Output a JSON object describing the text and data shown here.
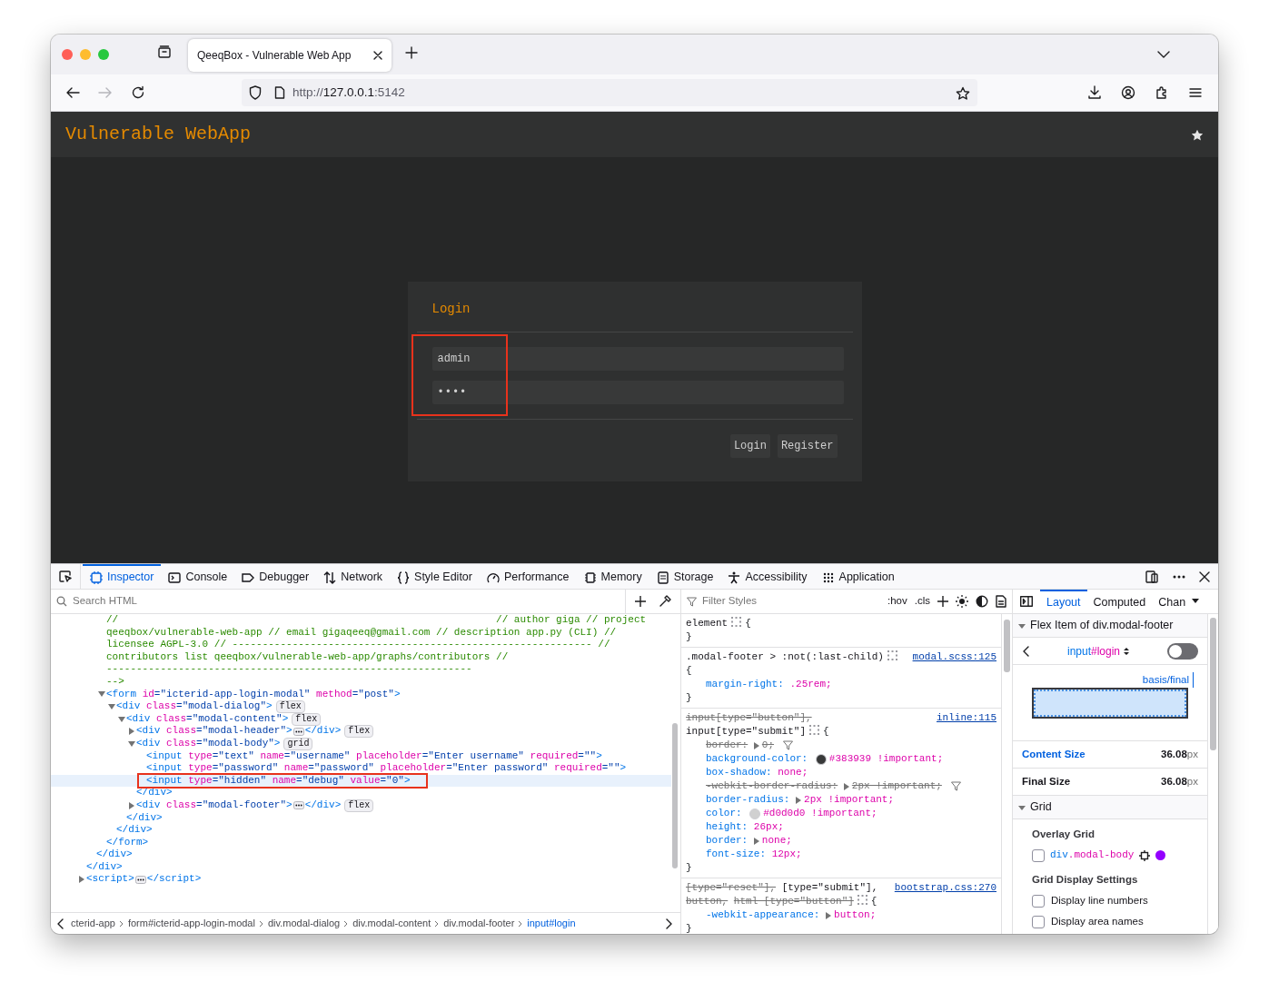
{
  "browser": {
    "tab": {
      "title": "QeeqBox - Vulnerable Web App"
    },
    "url": {
      "scheme": "http://",
      "host": "127.0.0.1",
      "port": ":5142"
    },
    "forward_disabled": true
  },
  "page": {
    "brand": "Vulnerable WebApp",
    "modal": {
      "title": "Login",
      "fields": [
        {
          "kind": "text",
          "value": "admin"
        },
        {
          "kind": "password",
          "value": "••••"
        }
      ],
      "buttons": [
        "Login",
        "Register"
      ]
    }
  },
  "devtools": {
    "tabs": [
      {
        "label": "Inspector",
        "selected": true
      },
      {
        "label": "Console",
        "selected": false
      },
      {
        "label": "Debugger",
        "selected": false
      },
      {
        "label": "Network",
        "selected": false
      },
      {
        "label": "Style Editor",
        "selected": false
      },
      {
        "label": "Performance",
        "selected": false
      },
      {
        "label": "Memory",
        "selected": false
      },
      {
        "label": "Storage",
        "selected": false
      },
      {
        "label": "Accessibility",
        "selected": false
      },
      {
        "label": "Application",
        "selected": false
      }
    ],
    "inspector": {
      "search_placeholder": "Search HTML",
      "tree": [
        {
          "kind": "tail",
          "close": "</div>",
          "children": [
            {
              "kind": "tail",
              "close": "</div>",
              "children": [
                {
                  "kind": "comment",
                  "lines": [
                    "//                                                               // author giga // project",
                    "qeeqbox/vulnerable-web-app // email gigaqeeq@gmail.com // description app.py (CLI) //",
                    "licensee AGPL-3.0 // ------------------------------------------------------------ //",
                    "contributors list qeeqbox/vulnerable-web-app/graphs/contributors //",
                    "-------------------------------------------------------------",
                    "-->"
                  ]
                },
                {
                  "kind": "element",
                  "open": "<form",
                  "attrs": [
                    {
                      "name": "id",
                      "value": "=\"icterid-app-login-modal\""
                    },
                    {
                      "name": "method",
                      "value": "=\"post\""
                    }
                  ],
                  "end": ">",
                  "close": "</form>",
                  "expanded": true,
                  "children": [
                    {
                      "kind": "element",
                      "open": "<div",
                      "attrs": [
                        {
                          "name": "class",
                          "value": "=\"modal-dialog\""
                        }
                      ],
                      "end": ">",
                      "close": "</div>",
                      "badge": "flex",
                      "expanded": true,
                      "children": [
                        {
                          "kind": "element",
                          "open": "<div",
                          "attrs": [
                            {
                              "name": "class",
                              "value": "=\"modal-content\""
                            }
                          ],
                          "end": ">",
                          "close": "</div>",
                          "badge": "flex",
                          "expanded": true,
                          "children": [
                            {
                              "kind": "element",
                              "open": "<div",
                              "attrs": [
                                {
                                  "name": "class",
                                  "value": "=\"modal-header\""
                                }
                              ],
                              "end": ">",
                              "close": "</div>",
                              "badge": "flex",
                              "expanded": false
                            },
                            {
                              "kind": "element",
                              "open": "<div",
                              "attrs": [
                                {
                                  "name": "class",
                                  "value": "=\"modal-body\""
                                }
                              ],
                              "end": ">",
                              "close": "</div>",
                              "badge": "grid",
                              "expanded": true,
                              "children": [
                                {
                                  "kind": "void",
                                  "open": "<input",
                                  "attrs": [
                                    {
                                      "name": "type",
                                      "value": "=\"text\""
                                    },
                                    {
                                      "name": "name",
                                      "value": "=\"username\""
                                    },
                                    {
                                      "name": "placeholder",
                                      "value": "=\"Enter username\""
                                    },
                                    {
                                      "name": "required",
                                      "value": "=\"\""
                                    }
                                  ],
                                  "end": ">",
                                  "highlighted": false
                                },
                                {
                                  "kind": "void",
                                  "open": "<input",
                                  "attrs": [
                                    {
                                      "name": "type",
                                      "value": "=\"password\""
                                    },
                                    {
                                      "name": "name",
                                      "value": "=\"password\""
                                    },
                                    {
                                      "name": "placeholder",
                                      "value": "=\"Enter password\""
                                    },
                                    {
                                      "name": "required",
                                      "value": "=\"\""
                                    }
                                  ],
                                  "end": ">",
                                  "highlighted": false
                                },
                                {
                                  "kind": "void",
                                  "open": "<input",
                                  "attrs": [
                                    {
                                      "name": "type",
                                      "value": "=\"hidden\""
                                    },
                                    {
                                      "name": "name",
                                      "value": "=\"debug\""
                                    },
                                    {
                                      "name": "value",
                                      "value": "=\"0\""
                                    }
                                  ],
                                  "end": ">",
                                  "highlighted": true
                                }
                              ]
                            },
                            {
                              "kind": "element",
                              "open": "<div",
                              "attrs": [
                                {
                                  "name": "class",
                                  "value": "=\"modal-footer\""
                                }
                              ],
                              "end": ">",
                              "close": "</div>",
                              "badge": "flex",
                              "expanded": false
                            }
                          ]
                        }
                      ]
                    }
                  ]
                }
              ]
            }
          ]
        },
        {
          "kind": "element",
          "open": "<script",
          "end": ">",
          "close": "</script>",
          "expanded": false
        }
      ],
      "breadcrumbs": [
        {
          "label": "cterid-app",
          "selected": false
        },
        {
          "label": "form#icterid-app-login-modal",
          "selected": false
        },
        {
          "label": "div.modal-dialog",
          "selected": false
        },
        {
          "label": "div.modal-content",
          "selected": false
        },
        {
          "label": "div.modal-footer",
          "selected": false
        },
        {
          "label": "input#login",
          "selected": true
        }
      ]
    },
    "styles": {
      "filter_placeholder": "Filter Styles",
      "toggles": [
        ":hov",
        ".cls"
      ],
      "rules": [
        {
          "selector": [
            {
              "text": "element",
              "overridden": false
            }
          ],
          "open": "{",
          "close": "}"
        },
        {
          "selector": [
            {
              "text": ".modal-footer > :not(:last-child)",
              "overridden": false
            }
          ],
          "source": "modal.scss:125",
          "open": "{",
          "close": "}",
          "declarations": [
            {
              "property": "margin-right:",
              "value": ".25rem;",
              "overridden": false,
              "flagged": false
            }
          ]
        },
        {
          "selector": [
            {
              "text": "input[type=\"button\"],",
              "overridden": true
            },
            {
              "text": "input[type=\"submit\"]",
              "overridden": false
            }
          ],
          "source": "inline:115",
          "open": "{",
          "close": "}",
          "declarations": [
            {
              "property": "border:",
              "value": "0;",
              "overridden": true,
              "flagged": true,
              "expanded": false
            },
            {
              "property": "background-color:",
              "value": "#383939 !important;",
              "overridden": false,
              "flagged": false,
              "color": "#383939"
            },
            {
              "property": "box-shadow:",
              "value": "none;",
              "overridden": false,
              "flagged": false
            },
            {
              "property": "-webkit-border-radius:",
              "value": "2px !important;",
              "overridden": true,
              "flagged": true,
              "expanded": false
            },
            {
              "property": "border-radius:",
              "value": "2px !important;",
              "overridden": false,
              "flagged": false,
              "expanded": false
            },
            {
              "property": "color:",
              "value": "#d0d0d0 !important;",
              "overridden": false,
              "flagged": false,
              "color": "#d0d0d0"
            },
            {
              "property": "height:",
              "value": "26px;",
              "overridden": false,
              "flagged": false
            },
            {
              "property": "border:",
              "value": "none;",
              "overridden": false,
              "flagged": false,
              "expanded": false
            },
            {
              "property": "font-size:",
              "value": "12px;",
              "overridden": false,
              "flagged": false
            }
          ]
        },
        {
          "selector": [
            {
              "text": "[type=\"reset\"],",
              "overridden": true
            },
            {
              "text": "[type=\"submit\"],",
              "overridden": false
            },
            {
              "text": "button,",
              "overridden": true
            },
            {
              "text": "html [type=\"button\"]",
              "overridden": true
            }
          ],
          "source": "bootstrap.css:270",
          "open": "{",
          "close": "}",
          "declarations": [
            {
              "property": "-webkit-appearance:",
              "value": "button;",
              "overridden": false,
              "flagged": false,
              "expanded": false
            }
          ]
        }
      ]
    },
    "layout": {
      "tabs": [
        {
          "label": "Layout",
          "selected": true
        },
        {
          "label": "Computed",
          "selected": false
        },
        {
          "label": "Chan",
          "selected": false
        }
      ],
      "flex_item": {
        "title": "Flex Item of div.modal-footer",
        "expanded": true,
        "element": {
          "tag": "input",
          "id": "#login"
        },
        "toggle_on": false,
        "axis_label": "basis/final",
        "sizes": [
          {
            "label": "Content Size",
            "value": "36.08",
            "unit": "px",
            "highlighted": true
          },
          {
            "label": "Final Size",
            "value": "36.08",
            "unit": "px",
            "highlighted": false
          }
        ]
      },
      "grid": {
        "title": "Grid",
        "expanded": true,
        "overlay_heading": "Overlay Grid",
        "overlays": [
          {
            "tag": "div",
            "cls": ".modal-body",
            "checked": false,
            "color": "#9400ff"
          }
        ],
        "settings_heading": "Grid Display Settings",
        "settings": [
          {
            "label": "Display line numbers",
            "checked": false
          },
          {
            "label": "Display area names",
            "checked": false
          }
        ]
      }
    }
  }
}
